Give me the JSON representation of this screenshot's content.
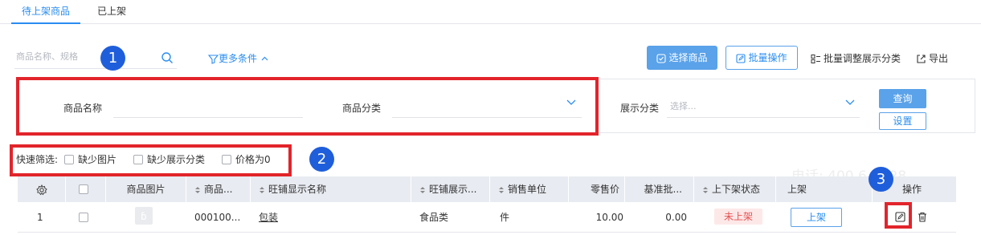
{
  "tabs": [
    {
      "label": "待上架商品",
      "active": true
    },
    {
      "label": "已上架",
      "active": false
    }
  ],
  "search": {
    "placeholder": "商品名称、规格",
    "icon": "search-icon"
  },
  "more_conditions": {
    "label": "更多条件",
    "icon": "filter-icon"
  },
  "toolbar": {
    "select_goods": "选择商品",
    "batch_ops": "批量操作",
    "batch_category": "批量调整展示分类",
    "export": "导出"
  },
  "filters": {
    "name_label": "商品名称",
    "category_label": "商品分类",
    "display_category_label": "展示分类",
    "display_category_placeholder": "选择...",
    "query": "查询",
    "reset": "设置"
  },
  "quick_filter": {
    "label": "快速筛选:",
    "options": [
      "缺少图片",
      "缺少展示分类",
      "价格为0"
    ]
  },
  "table": {
    "headers": [
      "商品图片",
      "商品...",
      "旺铺显示名称",
      "旺铺展示...",
      "销售单位",
      "零售价",
      "基准批...",
      "上下架状态",
      "上架",
      "操作"
    ],
    "rows": [
      {
        "index": "1",
        "code": "000100...",
        "name": "包装",
        "display_category": "食品类",
        "unit": "件",
        "retail_price": "10.00",
        "base_price": "0.00",
        "status": "未上架",
        "action": "上架"
      }
    ]
  },
  "annotations": [
    "1",
    "2",
    "3"
  ],
  "watermark": "电话: 400 6-0028",
  "colors": {
    "accent": "#2a8df0",
    "button": "#5aa2e9",
    "highlight": "#e2242b",
    "badge": "#1f5edb",
    "status_bg": "#fde8e8",
    "status_fg": "#e55353"
  }
}
